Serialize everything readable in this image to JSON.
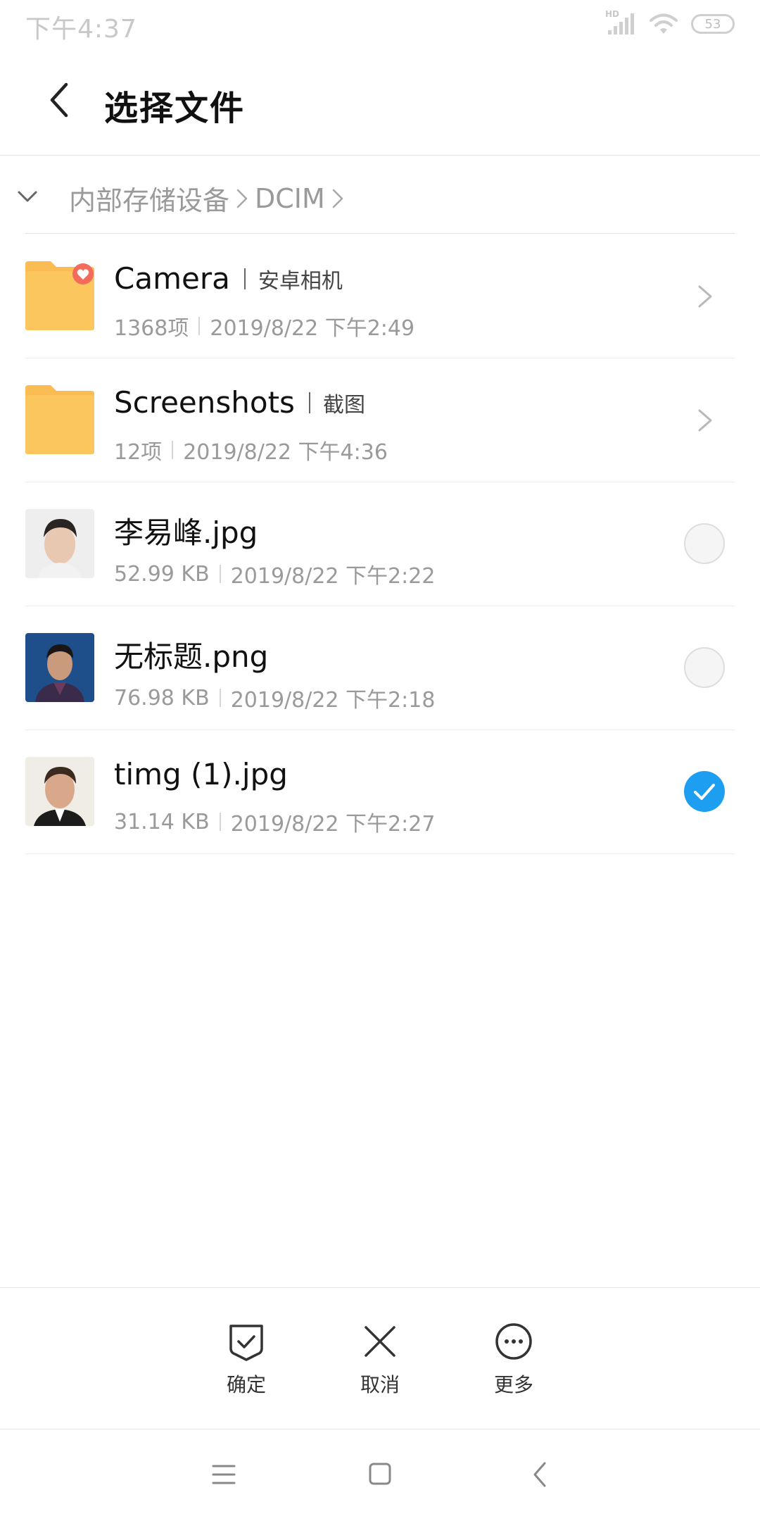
{
  "status_bar": {
    "time": "下午4:37",
    "signal_label": "HD",
    "battery": "53"
  },
  "header": {
    "title": "选择文件"
  },
  "breadcrumb": {
    "items": [
      "内部存储设备",
      "DCIM"
    ]
  },
  "files": [
    {
      "type": "folder",
      "name": "Camera",
      "tag": "安卓相机",
      "count": "1368项",
      "date": "2019/8/22 下午2:49",
      "badge": "heart"
    },
    {
      "type": "folder",
      "name": "Screenshots",
      "tag": "截图",
      "count": "12项",
      "date": "2019/8/22 下午4:36"
    },
    {
      "type": "file",
      "name": "李易峰.jpg",
      "size": "52.99 KB",
      "date": "2019/8/22 下午2:22",
      "selected": false
    },
    {
      "type": "file",
      "name": "无标题.png",
      "size": "76.98 KB",
      "date": "2019/8/22 下午2:18",
      "selected": false
    },
    {
      "type": "file",
      "name": "timg (1).jpg",
      "size": "31.14 KB",
      "date": "2019/8/22 下午2:27",
      "selected": true
    }
  ],
  "actions": {
    "confirm": "确定",
    "cancel": "取消",
    "more": "更多"
  },
  "colors": {
    "accent": "#1e9ef0",
    "folder": "#fbbd53",
    "badge": "#f36b5b"
  }
}
